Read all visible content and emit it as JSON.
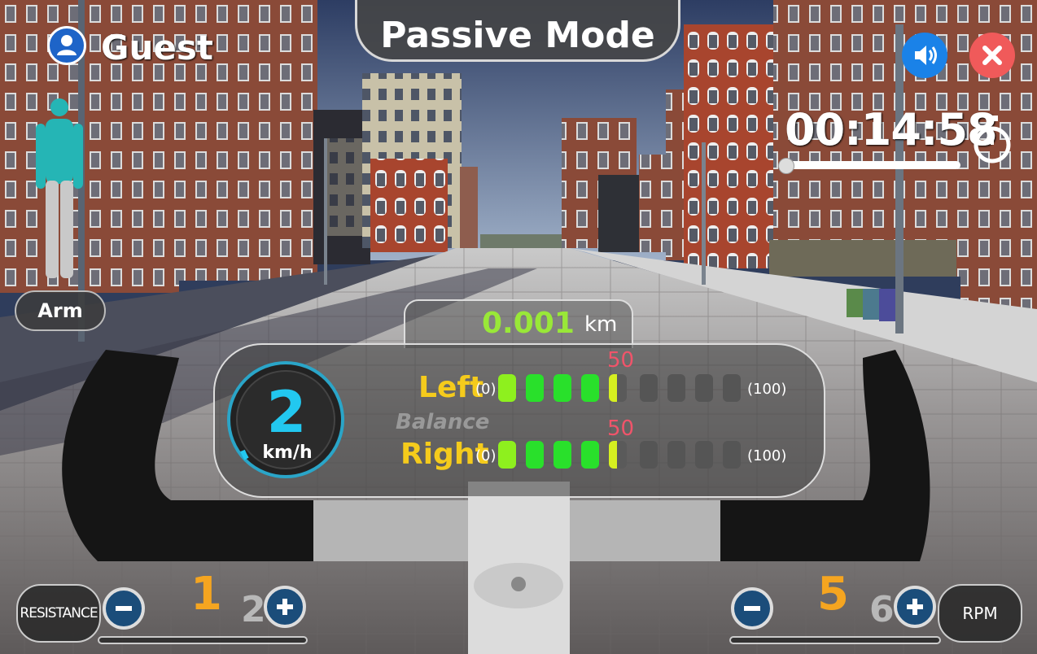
{
  "header": {
    "mode_title": "Passive Mode"
  },
  "user": {
    "name": "Guest",
    "avatar_icon": "user-icon"
  },
  "body_mode": {
    "label": "Arm"
  },
  "timer": {
    "elapsed": "00:14:58",
    "icon": "stopwatch-icon",
    "progress_fraction": 0.0
  },
  "distance": {
    "value": "0.001",
    "unit": "km"
  },
  "speed": {
    "value": "2",
    "unit": "km/h"
  },
  "balance": {
    "label": "Balance",
    "left": {
      "label": "Left",
      "min_label": "(0)",
      "max_label": "(100)",
      "value": 50,
      "marker_label": "50",
      "filled_segments": 4,
      "partial_segments": 1,
      "total_segments": 9
    },
    "right": {
      "label": "Right",
      "min_label": "(0)",
      "max_label": "(100)",
      "value": 50,
      "marker_label": "50",
      "filled_segments": 4,
      "partial_segments": 1,
      "total_segments": 9
    }
  },
  "resistance": {
    "label": "RESISTANCE",
    "current": "1",
    "next": "2",
    "minus_icon": "minus-icon",
    "plus_icon": "plus-icon"
  },
  "rpm": {
    "label": "RPM",
    "current": "5",
    "next": "6",
    "minus_icon": "minus-icon",
    "plus_icon": "plus-icon"
  },
  "controls": {
    "sound_icon": "speaker-icon",
    "close_icon": "close-icon"
  },
  "colors": {
    "accent_cyan": "#22c8f0",
    "distance_green": "#99e838",
    "label_yellow": "#f5cb1c",
    "marker_red": "#f0546a",
    "orange": "#f5a520"
  }
}
